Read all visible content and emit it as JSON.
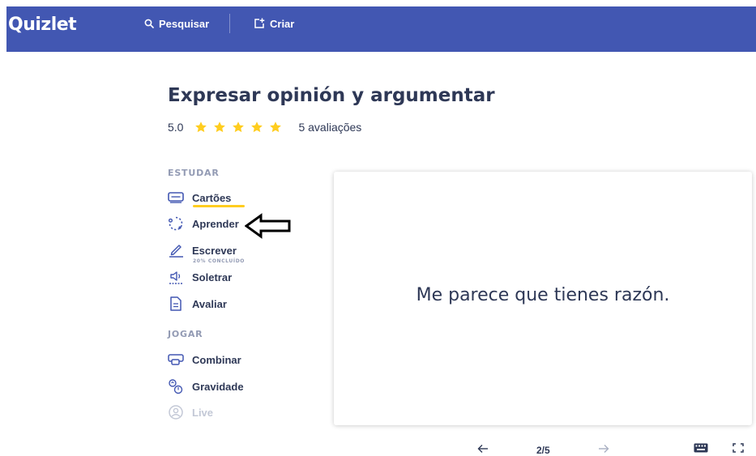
{
  "header": {
    "logo": "Quizlet",
    "search_label": "Pesquisar",
    "create_label": "Criar",
    "background_color": "#4257b2"
  },
  "set": {
    "title": "Expresar opinión y argumentar",
    "rating_score": "5.0",
    "rating_stars": 5,
    "rating_count": "5 avaliações",
    "star_color": "#ffcd1f"
  },
  "study": {
    "label": "ESTUDAR",
    "modes": [
      {
        "label": "Cartões",
        "icon": "cards-icon",
        "active": true
      },
      {
        "label": "Aprender",
        "icon": "learn-icon"
      },
      {
        "label": "Escrever",
        "icon": "write-icon",
        "sub": "20% CONCLUÍDO"
      },
      {
        "label": "Soletrar",
        "icon": "spell-icon"
      },
      {
        "label": "Avaliar",
        "icon": "test-icon"
      }
    ]
  },
  "play": {
    "label": "JOGAR",
    "modes": [
      {
        "label": "Combinar",
        "icon": "match-icon"
      },
      {
        "label": "Gravidade",
        "icon": "gravity-icon"
      },
      {
        "label": "Live",
        "icon": "live-icon",
        "disabled": true
      }
    ]
  },
  "flashcard": {
    "text": "Me parece que tienes razón.",
    "counter": "2/5"
  },
  "controls": {
    "prev_icon": "arrow-left-icon",
    "next_icon": "arrow-right-icon",
    "keyboard_icon": "keyboard-icon",
    "fullscreen_icon": "fullscreen-icon"
  }
}
